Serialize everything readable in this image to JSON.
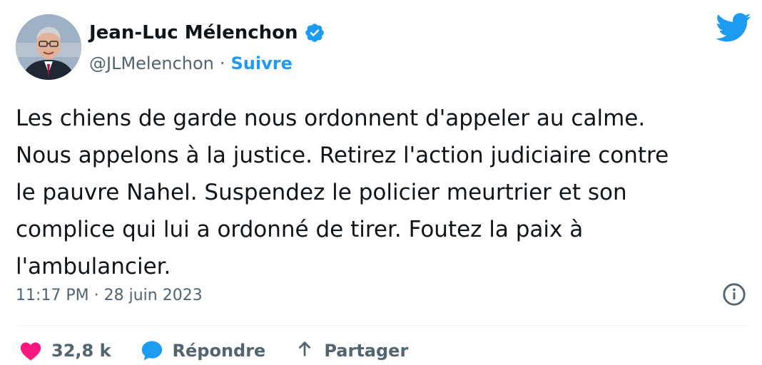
{
  "author": {
    "name": "Jean-Luc Mélenchon",
    "handle": "@JLMelenchon",
    "separator": "·",
    "follow_label": "Suivre",
    "verified_icon": "verified-badge-icon"
  },
  "tweet": {
    "text": "Les chiens de garde nous ordonnent d'appeler au calme.\nNous appelons à la justice. Retirez l'action judiciaire contre\nle pauvre Nahel. Suspendez le policier meurtrier et son\ncomplice qui lui a ordonné de tirer. Foutez la paix à\nl'ambulancier.",
    "timestamp": "11:17 PM · 28 juin 2023"
  },
  "actions": {
    "like_count": "32,8 k",
    "reply_label": "Répondre",
    "share_label": "Partager"
  },
  "icons": {
    "brand": "twitter-bird-icon",
    "info": "info-icon",
    "like": "heart-icon",
    "reply": "reply-bubble-icon",
    "share": "share-arrow-icon"
  },
  "colors": {
    "accent": "#1d9bf0",
    "like": "#f91880",
    "text": "#0f1419",
    "muted": "#536471"
  }
}
